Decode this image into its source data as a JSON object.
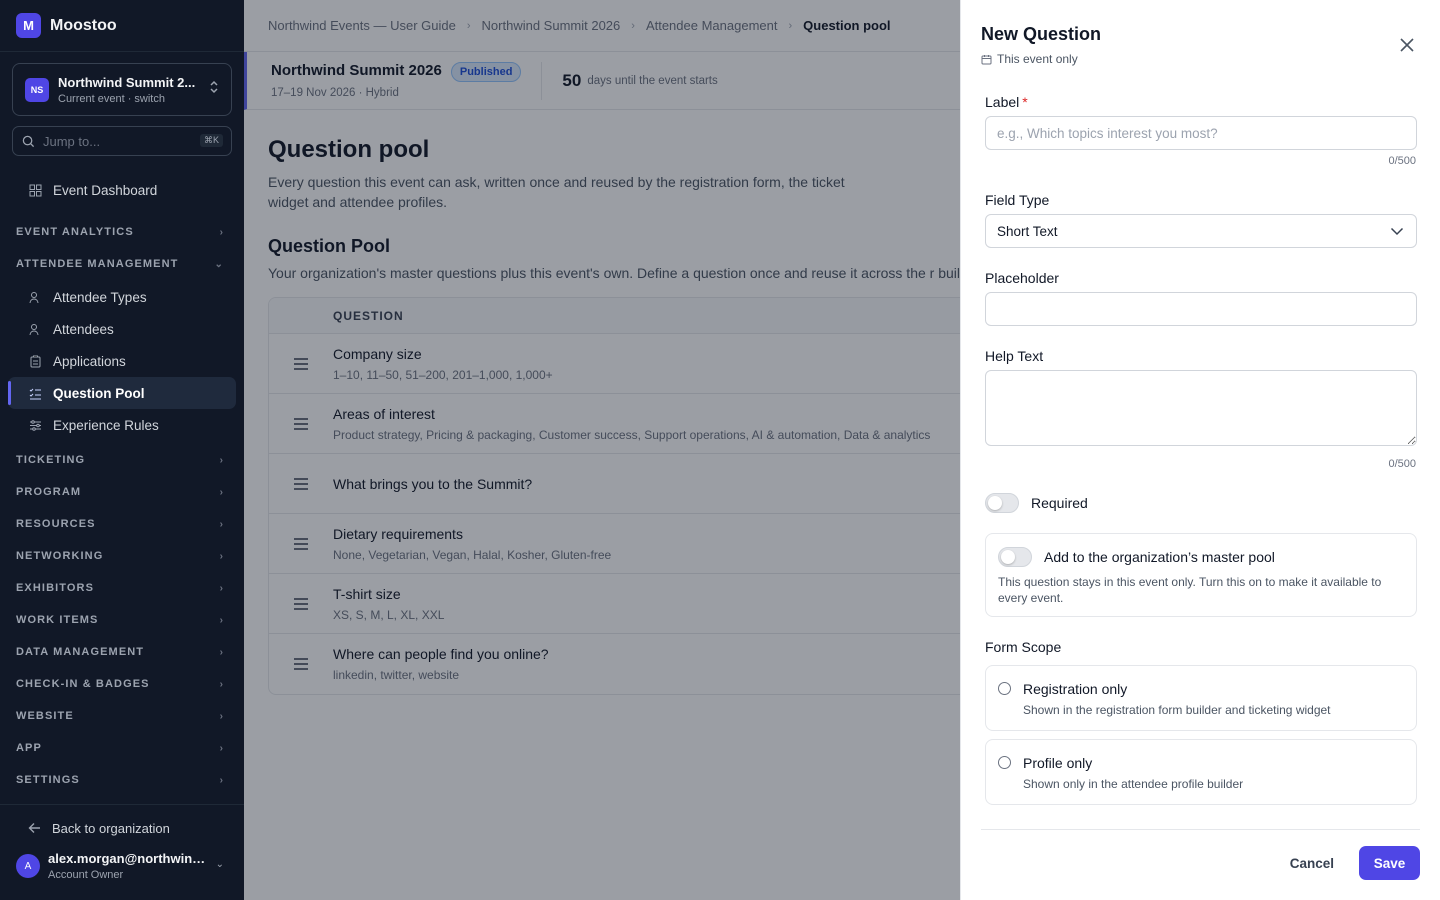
{
  "brand": {
    "logo_letter": "M",
    "name": "Moostoo"
  },
  "event_switcher": {
    "badge": "NS",
    "name": "Northwind Summit 2...",
    "sub": "Current event · switch"
  },
  "jump": {
    "placeholder": "Jump to...",
    "shortcut": "⌘K"
  },
  "sidebar": {
    "dashboard": "Event Dashboard",
    "sections_top": [
      {
        "label": "EVENT ANALYTICS"
      }
    ],
    "attendee_section": "ATTENDEE MANAGEMENT",
    "attendee_items": [
      {
        "label": "Attendee Types",
        "icon": "user-tag-icon"
      },
      {
        "label": "Attendees",
        "icon": "users-icon"
      },
      {
        "label": "Applications",
        "icon": "clipboard-icon"
      },
      {
        "label": "Question Pool",
        "icon": "list-check-icon",
        "active": true
      },
      {
        "label": "Experience Rules",
        "icon": "sliders-icon"
      }
    ],
    "sections": [
      "TICKETING",
      "PROGRAM",
      "RESOURCES",
      "NETWORKING",
      "EXHIBITORS",
      "WORK ITEMS",
      "DATA MANAGEMENT",
      "CHECK-IN & BADGES",
      "WEBSITE",
      "APP",
      "SETTINGS"
    ],
    "back": "Back to organization",
    "user": {
      "avatar": "A",
      "email": "alex.morgan@northwind...",
      "role": "Account Owner"
    }
  },
  "breadcrumbs": [
    "Northwind Events — User Guide",
    "Northwind Summit 2026",
    "Attendee Management",
    "Question pool"
  ],
  "event_bar": {
    "title": "Northwind Summit 2026",
    "status": "Published",
    "dates": "17–19 Nov 2026 · Hybrid",
    "days": "50",
    "days_label": "days until the event starts"
  },
  "page": {
    "title": "Question pool",
    "subtitle": "Every question this event can ask, written once and reused by the registration form, the ticket widget and attendee profiles.",
    "pool_title": "Question Pool",
    "pool_subtitle": "Your organization's master questions plus this event's own. Define a question once and reuse it across the r builder.",
    "table_header": "QUESTION",
    "questions": [
      {
        "label": "Company size",
        "options": "1–10, 11–50, 51–200, 201–1,000, 1,000+"
      },
      {
        "label": "Areas of interest",
        "options": "Product strategy, Pricing & packaging, Customer success, Support operations, AI & automation, Data & analytics"
      },
      {
        "label": "What brings you to the Summit?",
        "options": ""
      },
      {
        "label": "Dietary requirements",
        "options": "None, Vegetarian, Vegan, Halal, Kosher, Gluten-free"
      },
      {
        "label": "T-shirt size",
        "options": "XS, S, M, L, XL, XXL"
      },
      {
        "label": "Where can people find you online?",
        "options": "linkedin, twitter, website"
      }
    ]
  },
  "panel": {
    "title": "New Question",
    "scope": "This event only",
    "label_field": {
      "label": "Label",
      "required_mark": "*",
      "placeholder": "e.g., Which topics interest you most?",
      "counter": "0/500"
    },
    "field_type": {
      "label": "Field Type",
      "value": "Short Text"
    },
    "placeholder_field": {
      "label": "Placeholder",
      "value": ""
    },
    "help_text": {
      "label": "Help Text",
      "counter": "0/500"
    },
    "required": {
      "label": "Required",
      "on": false
    },
    "master_pool": {
      "label": "Add to the organization’s master pool",
      "desc": "This question stays in this event only. Turn this on to make it available to every event.",
      "on": false
    },
    "form_scope": {
      "label": "Form Scope",
      "options": [
        {
          "title": "Registration only",
          "desc": "Shown in the registration form builder and ticketing widget"
        },
        {
          "title": "Profile only",
          "desc": "Shown only in the attendee profile builder"
        }
      ]
    },
    "cancel": "Cancel",
    "save": "Save"
  },
  "colors": {
    "accent": "#4f46e5",
    "sidebar_bg": "#111827",
    "published": "#1d4ed8"
  }
}
